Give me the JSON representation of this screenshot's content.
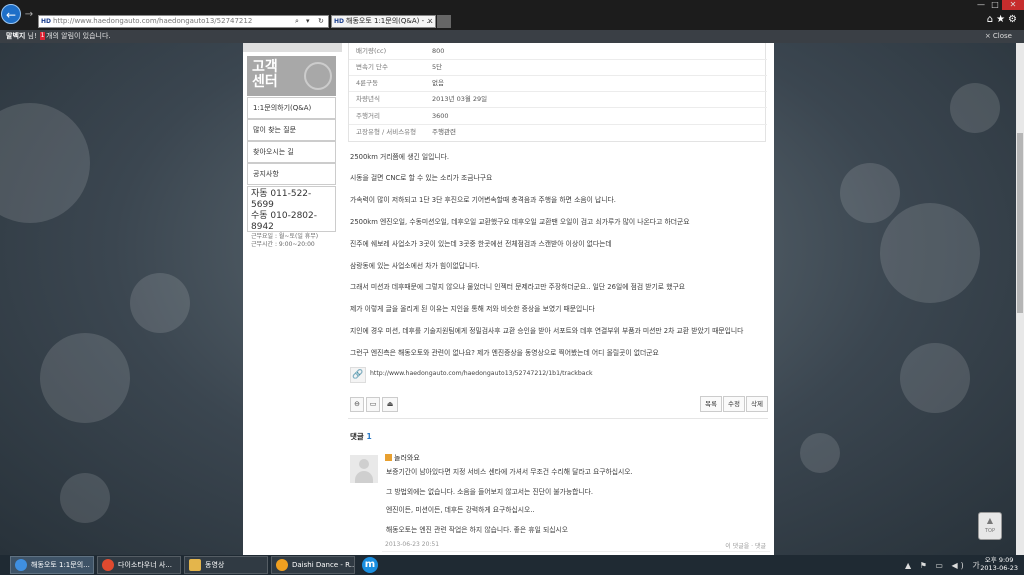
{
  "browser": {
    "address_prefix": "HD",
    "address": "http://www.haedongauto.com/haedongauto13/52747212",
    "tab_prefix": "HD",
    "tab_title": "해동오토 1:1문의(Q&A) - ...",
    "tab_close": "×",
    "back_icon": "←",
    "forward_icon": "→",
    "window_controls": [
      "—",
      "□",
      "✕"
    ],
    "toolbar_icons": [
      "⌂",
      "★",
      "⚙"
    ],
    "address_icons": [
      "⌕",
      "▾",
      "↻"
    ]
  },
  "notification": {
    "user": "말벡지",
    "text_before": " 님! ",
    "count": "1",
    "text_after": "개의 알림이 있습니다.",
    "close": "× Close"
  },
  "sidebar": {
    "title": "고객\n센터",
    "menu": [
      "1:1문의하기(Q&A)",
      "많이 찾는 질문",
      "찾아오시는 길",
      "공지사항"
    ],
    "phones": [
      "자동  011-522-5699",
      "수동  010-2802-8942"
    ],
    "hours": [
      "근무요일 : 월~토(일 휴무)",
      "근무시간 : 9:00~20:00"
    ]
  },
  "info_table": [
    {
      "key": "배기량(cc)",
      "value": "800"
    },
    {
      "key": "변속기 단수",
      "value": "5단"
    },
    {
      "key": "4륜구동",
      "value": "없음"
    },
    {
      "key": "차량년식",
      "value": "2013년 03월 29일"
    },
    {
      "key": "주행거리",
      "value": "3600"
    },
    {
      "key": "고장유형 / 서비스유형",
      "value": "주행관련"
    }
  ],
  "post_paragraphs": [
    "2500km 거리쯤에 생긴 일입니다.",
    "시동을 걸면 CNC로 할 수 있는 소리가 조금나구요",
    "가속력이 많이 저하되고 1단 3단 후진으로 기어변속할때 충격음과 주행을 하면 소음이 납니다.",
    "2500km 엔진오일, 수동미션오일, 데후오일 교환했구요 데후오일 교환땐 오일이 검고 쇠가루가 많이 나온다고 하더군요",
    "진주에 쉐보레 사업소가 3곳이 있는데 3곳중 한곳에선 전체점검과 스캔받아 이상이 없다는데",
    "삼랑동에 있는 사업소에선 차가 힘이없답니다.",
    "그래서 미션과 데후때문에 그렇지 않으냐 물었더니 인젝터 문제라고만 주장하더군요.. 일단 26일에 점검 받기로 했구요",
    "제가 이렇게 글을 올리게 된 이유는 지인을 통해 저와 비슷한 증상을 보였기 때문입니다",
    "지인에 경우 미션, 데후를 기술지원팀에게 정밀검사후 교환 승인을 받아 서포트와 데후 연결부위 부품과 미션만 2차 교환 받았기 때문입니다",
    "그런구 엔진측은 해동오토와 관련이 없나요? 제가 엔진증상을 동영상으로 찍어봤는데 어디 올릴곳이 없더군요"
  ],
  "trackback": {
    "icon": "🔗",
    "url": "http://www.haedongauto.com/haedongauto13/52747212/1b1/trackback"
  },
  "post_actions": {
    "left_icons": [
      "⊖",
      "▭",
      "⏏"
    ],
    "right": [
      "목록",
      "수정",
      "삭제"
    ]
  },
  "comments_section": {
    "label": "댓글",
    "count": "1"
  },
  "comment": {
    "author": "놀러와요",
    "lines": [
      "보증기간이 남아있다면 지정 서비스 센타에 가셔서 무조건 수리해 달라고 요구하십시오.",
      "그 방법외에는 없습니다. 소음을 들어보지 않고서는 진단이 불가능합니다.",
      "엔진이든, 미션이든, 데후든 강력하게 요구하십시오..",
      "해동오토는 엔진 관련 작업은 하지 않습니다. 좋은 휴일 되십시오"
    ],
    "date": "2013-06-23 20:51",
    "actions": "이 댓글을 · 댓글"
  },
  "top_button": "TOP",
  "taskbar": {
    "apps": [
      {
        "label": "해동오토 1:1문의...",
        "icon_color": "#3f8fe0"
      },
      {
        "label": "다이소타우너 사...",
        "icon_color": "#e04a2f"
      },
      {
        "label": "동영상",
        "icon_color": "#e4b54b"
      },
      {
        "label": "Daishi Dance - R...",
        "icon_color": "#f0a020"
      }
    ],
    "m_icon": "m",
    "tray_icons": "▲ ⚑ ▭ ◀) 가",
    "clock_time": "오후 9:09",
    "clock_date": "2013-06-23"
  },
  "colors": {
    "accent": "#1e6fc8",
    "comment_count": "#2a7ac6",
    "background": "#3b4650"
  }
}
